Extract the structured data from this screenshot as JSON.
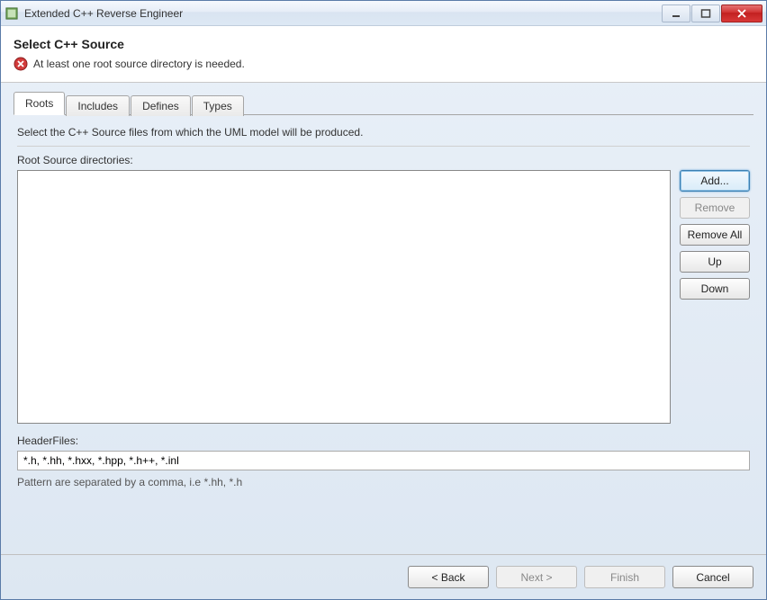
{
  "window": {
    "title": "Extended C++ Reverse Engineer"
  },
  "header": {
    "title": "Select C++ Source",
    "error_message": "At least one root source directory is needed."
  },
  "tabs": {
    "roots": "Roots",
    "includes": "Includes",
    "defines": "Defines",
    "types": "Types"
  },
  "roots_tab": {
    "description": "Select the C++ Source files from which the UML model will be produced.",
    "list_label": "Root Source directories:",
    "buttons": {
      "add": "Add...",
      "remove": "Remove",
      "remove_all": "Remove All",
      "up": "Up",
      "down": "Down"
    },
    "headerfiles_label": "HeaderFiles:",
    "headerfiles_value": "*.h, *.hh, *.hxx, *.hpp, *.h++, *.inl",
    "pattern_hint": "Pattern are separated by a comma, i.e *.hh, *.h"
  },
  "footer": {
    "back": "< Back",
    "next": "Next >",
    "finish": "Finish",
    "cancel": "Cancel"
  }
}
